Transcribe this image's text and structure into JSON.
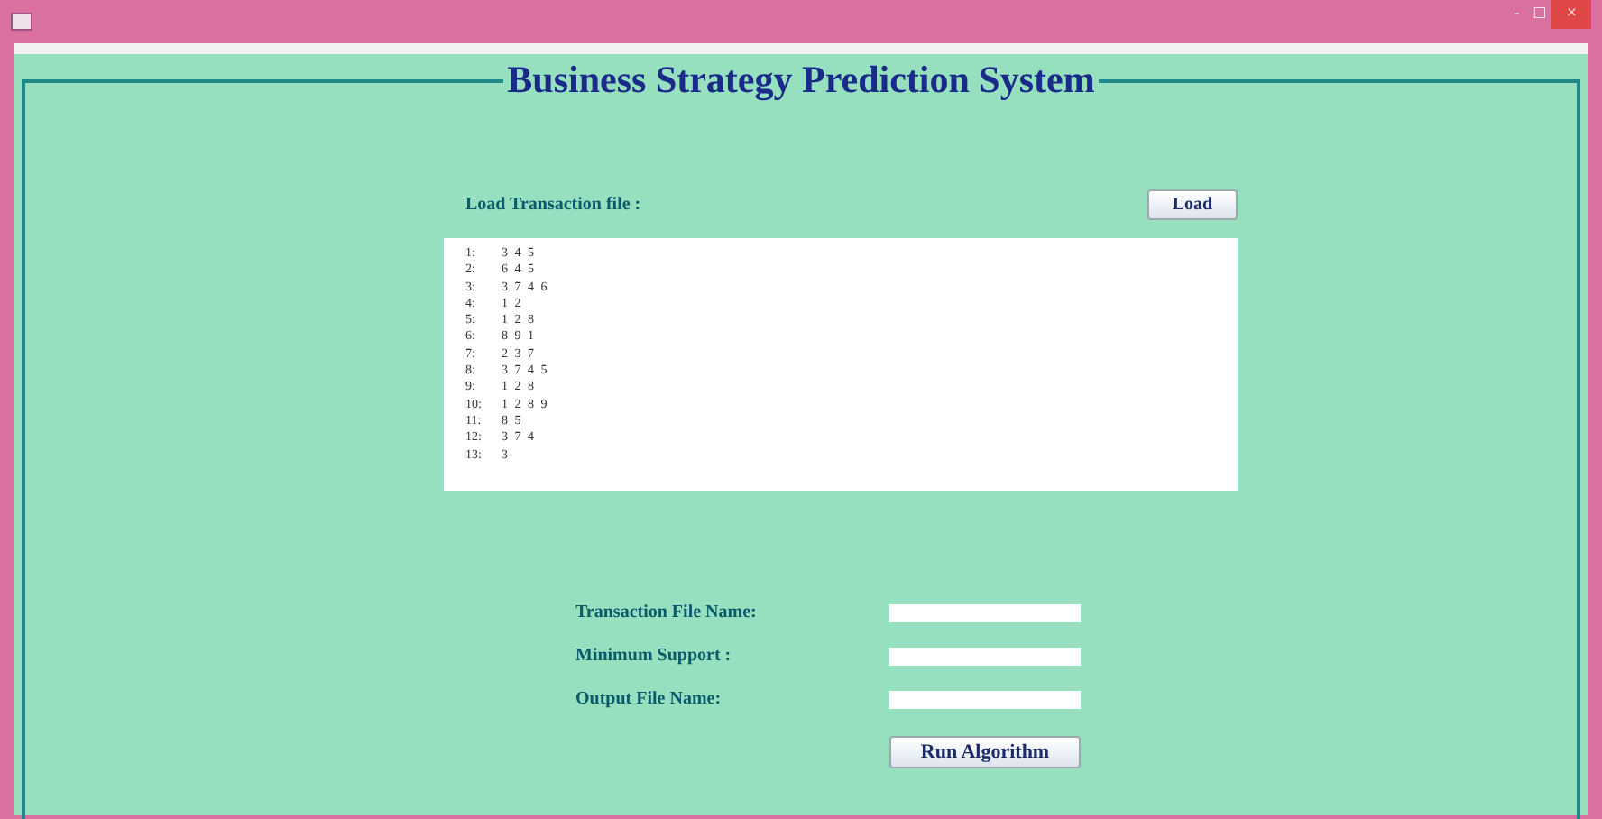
{
  "window": {
    "title_buttons": [
      "-",
      "□",
      "×"
    ]
  },
  "panel": {
    "title": "Business Strategy Prediction System"
  },
  "load": {
    "label": "Load Transaction file :",
    "button": "Load"
  },
  "transactions": [
    {
      "index": "1:",
      "items": "3 4 5"
    },
    {
      "index": "2:",
      "items": "6 4 5"
    },
    {
      "index": "3:",
      "items": "3 7 4 6"
    },
    {
      "index": "4:",
      "items": "1 2"
    },
    {
      "index": "5:",
      "items": "1 2 8"
    },
    {
      "index": "6:",
      "items": "8 9 1"
    },
    {
      "index": "7:",
      "items": "2 3 7"
    },
    {
      "index": "8:",
      "items": "3 7 4 5"
    },
    {
      "index": "9:",
      "items": "1 2 8"
    },
    {
      "index": "10:",
      "items": "1 2 8 9"
    },
    {
      "index": "11:",
      "items": "8 5"
    },
    {
      "index": "12:",
      "items": "3 7 4"
    },
    {
      "index": "13:",
      "items": "3"
    }
  ],
  "form": {
    "fields": [
      {
        "label": "Transaction File Name:"
      },
      {
        "label": "Minimum Support :"
      },
      {
        "label": "Output File Name:"
      }
    ],
    "button": "Run Algorithm"
  }
}
